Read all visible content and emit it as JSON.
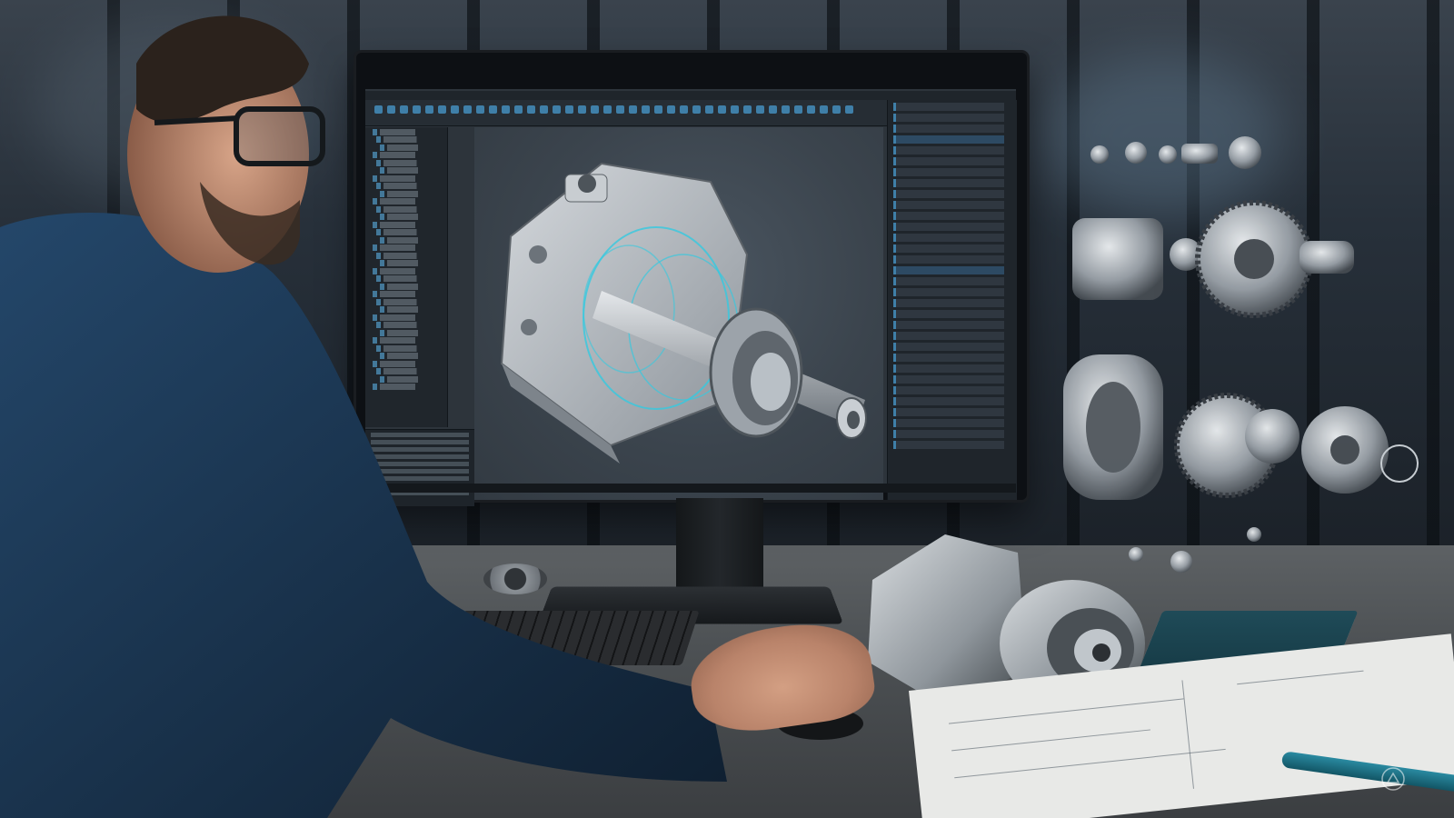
{
  "scene": {
    "description_tag": "photo",
    "colors": {
      "shirt": "#1d3a52",
      "accent_cyan": "#35c9e0",
      "metal": "#a6adb3",
      "notebook": "#1f4b58"
    }
  },
  "ui": {
    "icon_names": [
      "cad-toolbar-icon",
      "feature-tree-icon",
      "properties-panel-icon",
      "taskbar-icon"
    ]
  }
}
